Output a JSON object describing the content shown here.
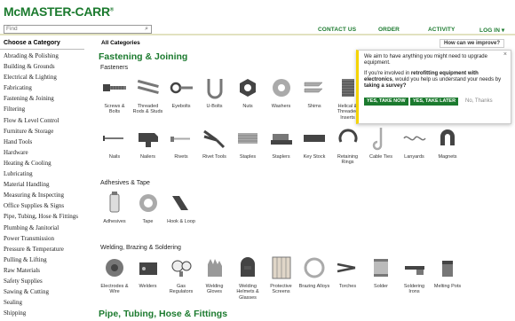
{
  "header": {
    "logo": "McMASTER-CARR",
    "logo_mark": "®",
    "search_placeholder": "Find",
    "nav": {
      "contact": "CONTACT US",
      "order": "ORDER",
      "activity": "ACTIVITY",
      "login": "LOG IN ▾"
    }
  },
  "sidebar": {
    "title": "Choose a Category",
    "items": [
      "Abrading & Polishing",
      "Building & Grounds",
      "Electrical & Lighting",
      "Fabricating",
      "Fastening & Joining",
      "Filtering",
      "Flow & Level Control",
      "Furniture & Storage",
      "Hand Tools",
      "Hardware",
      "Heating & Cooling",
      "Lubricating",
      "Material Handling",
      "Measuring & Inspecting",
      "Office Supplies & Signs",
      "Pipe, Tubing, Hose & Fittings",
      "Plumbing & Janitorial",
      "Power Transmission",
      "Pressure & Temperature",
      "Pulling & Lifting",
      "Raw Materials",
      "Safety Supplies",
      "Sawing & Cutting",
      "Sealing",
      "Shipping"
    ]
  },
  "main": {
    "heading": "All Categories",
    "feedback_button": "How can we improve?",
    "section1_title": "Fastening & Joining",
    "section2_title": "Pipe, Tubing, Hose & Fittings",
    "groups": {
      "fasteners": "Fasteners",
      "adhesives": "Adhesives & Tape",
      "welding": "Welding, Brazing & Soldering"
    },
    "tiles_row1": [
      {
        "label": "Screws & Bolts",
        "icon": "screw-icon"
      },
      {
        "label": "Threaded Rods & Studs",
        "icon": "threaded-rod-icon"
      },
      {
        "label": "Eyebolts",
        "icon": "eyebolt-icon"
      },
      {
        "label": "U-Bolts",
        "icon": "u-bolt-icon"
      },
      {
        "label": "Nuts",
        "icon": "nut-icon"
      },
      {
        "label": "Washers",
        "icon": "washer-icon"
      },
      {
        "label": "Shims",
        "icon": "shim-icon"
      },
      {
        "label": "Helical & Threaded Inserts",
        "icon": "insert-icon"
      }
    ],
    "tiles_row2": [
      {
        "label": "Nails",
        "icon": "nail-icon"
      },
      {
        "label": "Nailers",
        "icon": "nailer-icon"
      },
      {
        "label": "Rivets",
        "icon": "rivet-icon"
      },
      {
        "label": "Rivet Tools",
        "icon": "rivet-tool-icon"
      },
      {
        "label": "Staples",
        "icon": "staple-icon"
      },
      {
        "label": "Staplers",
        "icon": "stapler-icon"
      },
      {
        "label": "Key Stock",
        "icon": "key-stock-icon"
      },
      {
        "label": "Retaining Rings",
        "icon": "retaining-ring-icon"
      },
      {
        "label": "Cable Ties",
        "icon": "cable-tie-icon"
      },
      {
        "label": "Lanyards",
        "icon": "lanyard-icon"
      },
      {
        "label": "Magnets",
        "icon": "magnet-icon"
      }
    ],
    "tiles_adhesives": [
      {
        "label": "Adhesives",
        "icon": "adhesive-icon"
      },
      {
        "label": "Tape",
        "icon": "tape-icon"
      },
      {
        "label": "Hook & Loop",
        "icon": "hook-loop-icon"
      }
    ],
    "tiles_welding": [
      {
        "label": "Electrodes & Wire",
        "icon": "electrode-icon"
      },
      {
        "label": "Welders",
        "icon": "welder-icon"
      },
      {
        "label": "Gas Regulators",
        "icon": "regulator-icon"
      },
      {
        "label": "Welding Gloves",
        "icon": "glove-icon"
      },
      {
        "label": "Welding Helmets & Glasses",
        "icon": "helmet-icon"
      },
      {
        "label": "Protective Screens",
        "icon": "screen-icon"
      },
      {
        "label": "Brazing Alloys",
        "icon": "brazing-icon"
      },
      {
        "label": "Torches",
        "icon": "torch-icon"
      },
      {
        "label": "Solder",
        "icon": "solder-icon"
      },
      {
        "label": "Soldering Irons",
        "icon": "soldering-iron-icon"
      },
      {
        "label": "Melting Pots",
        "icon": "melting-pot-icon"
      }
    ]
  },
  "popup": {
    "line1": "We aim to have anything you might need to upgrade equipment.",
    "line2_a": "If you're involved in ",
    "line2_b": "retrofitting equipment with electronics",
    "line2_c": ", would you help us understand your needs by ",
    "line2_d": "taking a survey?",
    "yes_now": "YES, TAKE NOW",
    "yes_later": "YES, TAKE LATER",
    "no": "No, Thanks",
    "close": "×"
  },
  "colors": {
    "brand": "#1b7a2e",
    "popup_accent": "#f5d400"
  }
}
